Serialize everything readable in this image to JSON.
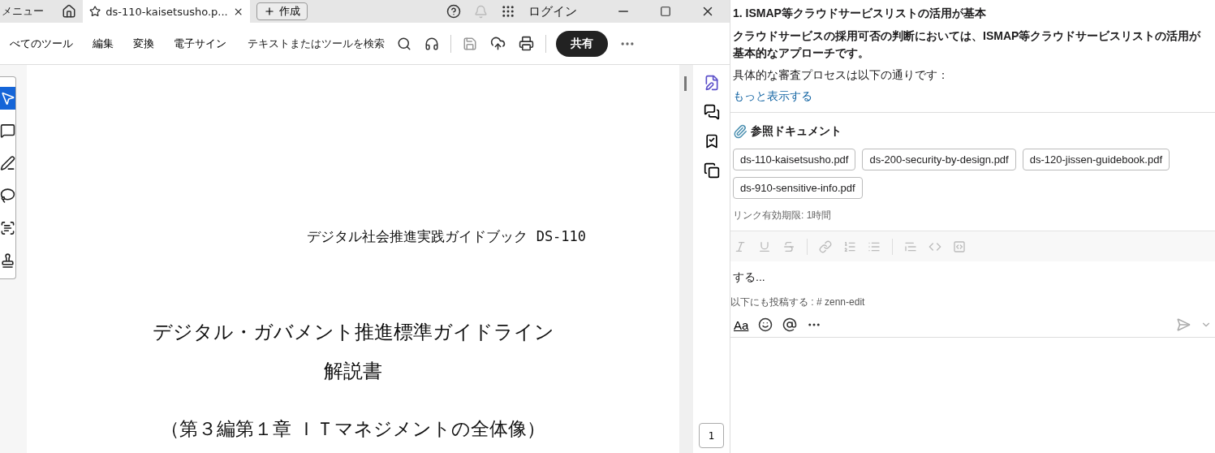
{
  "browser": {
    "menu": "メニュー",
    "tab_title": "ds-110-kaisetsusho.p...",
    "create_button": "作成",
    "login": "ログイン"
  },
  "toolbar": {
    "items": [
      {
        "label": "べてのツール",
        "selected": false
      },
      {
        "label": "編集",
        "selected": false
      },
      {
        "label": "変換",
        "selected": false
      },
      {
        "label": "電子サイン",
        "selected": false
      }
    ],
    "search_placeholder": "テキストまたはツールを検索",
    "share_button": "共有"
  },
  "tools": [
    {
      "kind": "select",
      "selected": true
    },
    {
      "kind": "comment",
      "selected": false
    },
    {
      "kind": "draw",
      "selected": false
    },
    {
      "kind": "lasso",
      "selected": false
    },
    {
      "kind": "text",
      "selected": false
    },
    {
      "kind": "sign",
      "selected": false
    }
  ],
  "document": {
    "header": "デジタル社会推進実践ガイドブック DS-110",
    "title_lines": [
      "デジタル・ガバメント推進標準ガイドライン",
      "解説書"
    ],
    "subtitle": "（第３編第１章 ＩＴマネジメントの全体像）",
    "page_number": "1"
  },
  "chat": {
    "heading": "1. ISMAP等クラウドサービスリストの活用が基本",
    "bold_text": "クラウドサービスの採用可否の判断においては、ISMAP等クラウドサービスリストの活用が基本的なアプローチです。",
    "text": "具体的な審査プロセスは以下の通りです：",
    "more_link": "もっと表示する",
    "references_title": "参照ドキュメント",
    "references": [
      "ds-110-kaisetsusho.pdf",
      "ds-200-security-by-design.pdf",
      "ds-120-jissen-guidebook.pdf",
      "ds-910-sensitive-info.pdf"
    ],
    "link_expiry": "リンク有効期限: 1時間",
    "composer": {
      "value": "する...",
      "also_post": "以下にも投稿する : # zenn-edit",
      "format_button": "Aa"
    }
  }
}
